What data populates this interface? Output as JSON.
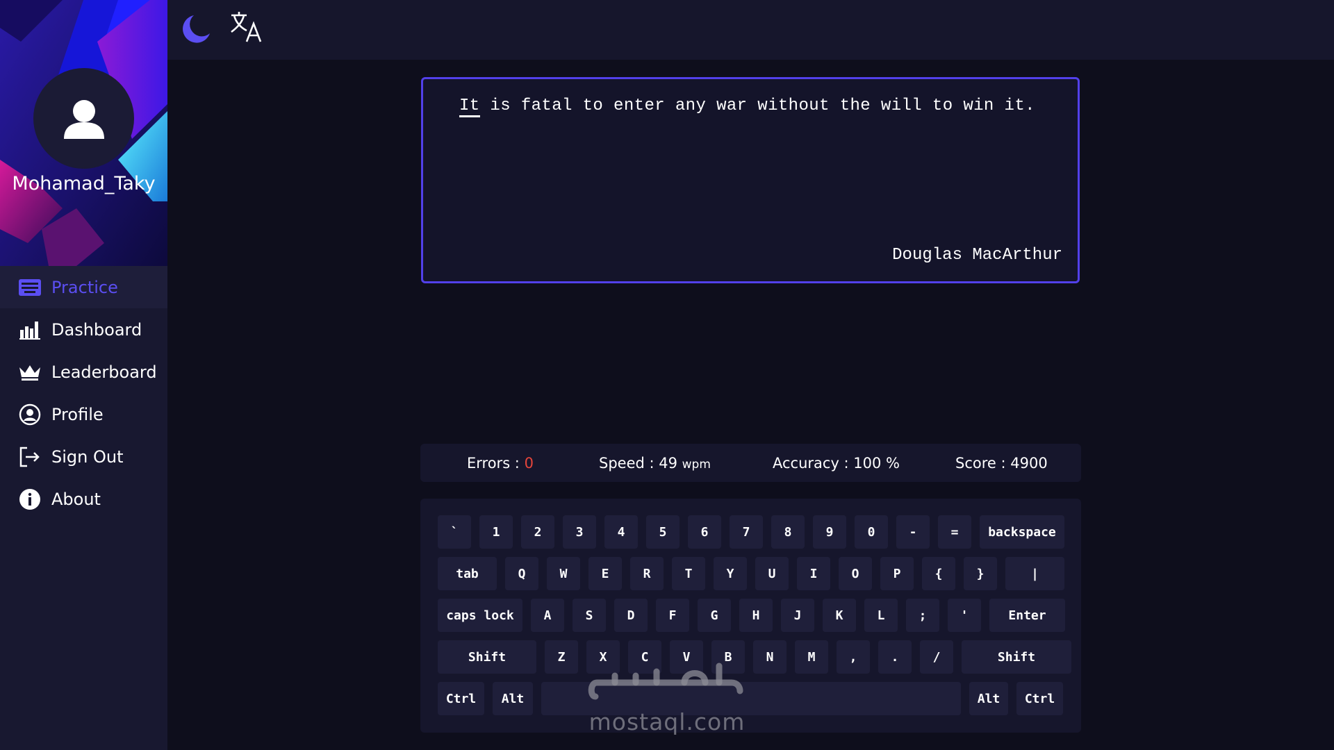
{
  "user": {
    "name": "Mohamad_Taky"
  },
  "nav": [
    {
      "label": "Practice",
      "icon": "keyboard-icon",
      "active": true
    },
    {
      "label": "Dashboard",
      "icon": "bar-chart-icon",
      "active": false
    },
    {
      "label": "Leaderboard",
      "icon": "crown-icon",
      "active": false
    },
    {
      "label": "Profile",
      "icon": "user-circle-icon",
      "active": false
    },
    {
      "label": "Sign Out",
      "icon": "sign-out-icon",
      "active": false
    },
    {
      "label": "About",
      "icon": "info-icon",
      "active": false
    }
  ],
  "topbar": {
    "theme_icon": "moon-icon",
    "language_icon": "translate-icon"
  },
  "quote": {
    "current_word": "It",
    "rest": " is fatal to enter any war without the will to win it.",
    "author": "Douglas MacArthur"
  },
  "stats": {
    "errors_label": "Errors : ",
    "errors_value": "0",
    "speed_label": "Speed : 49 ",
    "speed_unit": "wpm",
    "accuracy": "Accuracy : 100 %",
    "score": "Score : 4900"
  },
  "keyboard": {
    "row1": [
      "`",
      "1",
      "2",
      "3",
      "4",
      "5",
      "6",
      "7",
      "8",
      "9",
      "0",
      "-",
      "=",
      "backspace"
    ],
    "row2": [
      "tab",
      "Q",
      "W",
      "E",
      "R",
      "T",
      "Y",
      "U",
      "I",
      "O",
      "P",
      "{",
      "}",
      "|"
    ],
    "row3": [
      "caps lock",
      "A",
      "S",
      "D",
      "F",
      "G",
      "H",
      "J",
      "K",
      "L",
      ";",
      "'",
      "Enter"
    ],
    "row4": [
      "Shift",
      "Z",
      "X",
      "C",
      "V",
      "B",
      "N",
      "M",
      ",",
      ".",
      "/",
      "Shift"
    ],
    "row5": [
      "Ctrl",
      "Alt",
      "",
      "Alt",
      "Ctrl"
    ]
  },
  "watermark": {
    "text": "mostaql.com"
  },
  "colors": {
    "accent": "#5240ea",
    "error": "#e5453b",
    "background": "#0e0e1c",
    "sidebar": "#181830"
  }
}
